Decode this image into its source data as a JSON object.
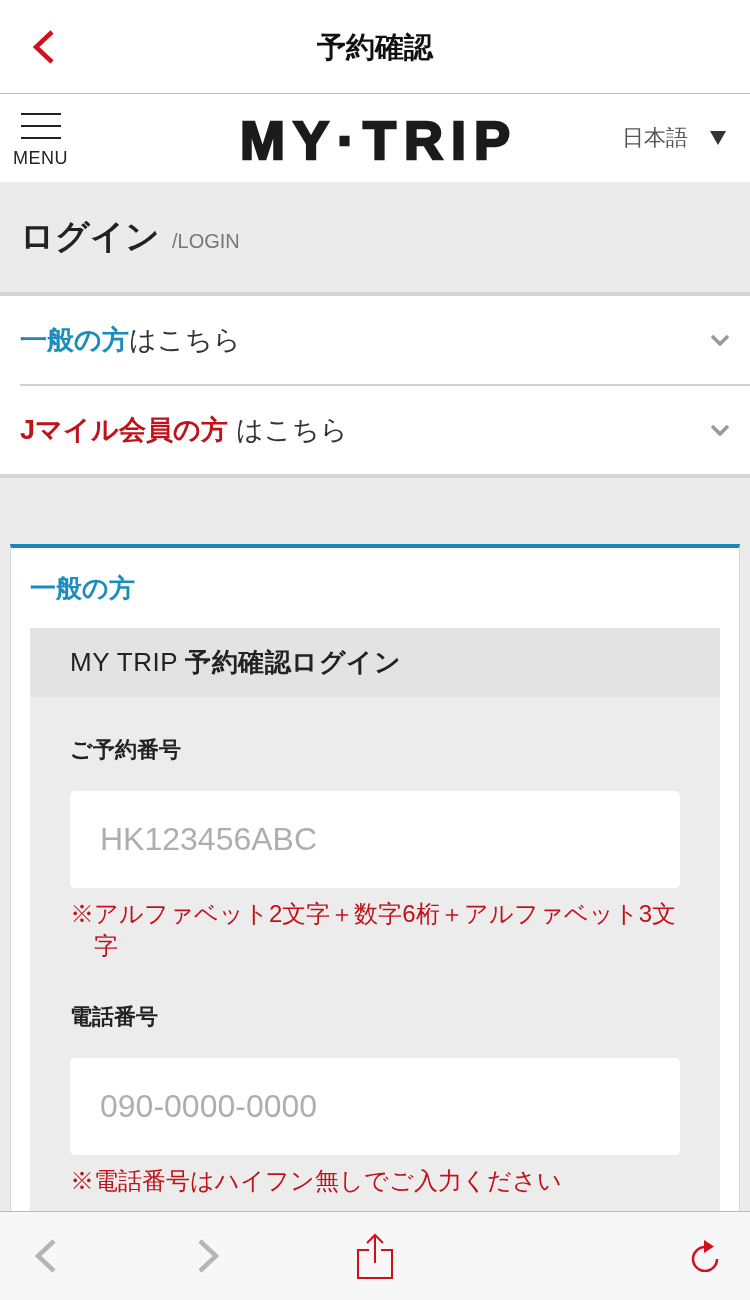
{
  "app_bar": {
    "title": "予約確認"
  },
  "site_header": {
    "menu_label": "MENU",
    "logo": "MY·TRIP",
    "language": "日本語"
  },
  "page_heading": {
    "title": "ログイン",
    "subtitle": "/LOGIN"
  },
  "login_options": [
    {
      "label": "**一般の方**はこちら",
      "color": "#1a8cbd",
      "expanded": false
    },
    {
      "label": "**Jマイル会員の方** はこちら",
      "color": "#c0121a",
      "expanded": false
    }
  ],
  "login_card": {
    "title": "一般の方",
    "panel_title": "MY TRIP **予約確認ログイン**",
    "fields": [
      {
        "label": "ご予約番号",
        "placeholder": "HK123456ABC",
        "note": "※アルファベット2文字＋数字6桁＋アルファベット3文字"
      },
      {
        "label": "電話番号",
        "placeholder": "090-0000-0000",
        "note": "※電話番号はハイフン無しでご入力ください"
      }
    ]
  },
  "browser_toolbar": {
    "buttons": [
      {
        "kind": "back",
        "disabled": true
      },
      {
        "kind": "forward",
        "disabled": true
      },
      {
        "kind": "share",
        "disabled": false
      },
      {
        "kind": "reload",
        "disabled": false
      }
    ]
  }
}
